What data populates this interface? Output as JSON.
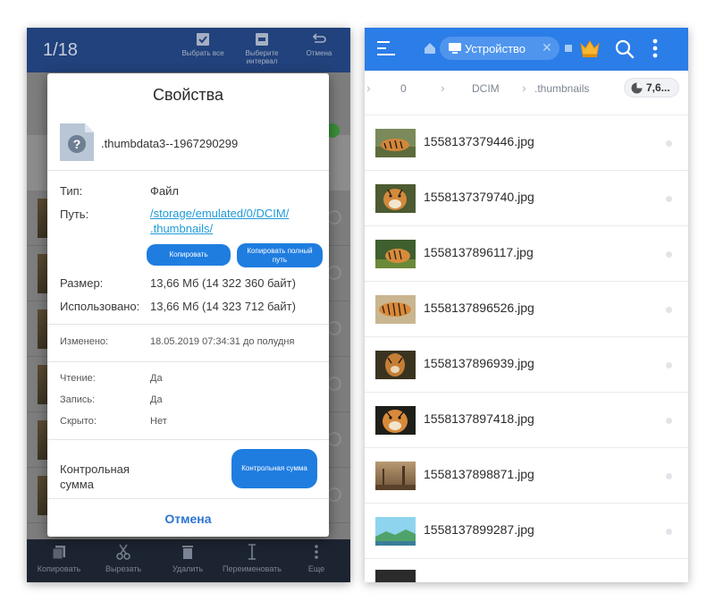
{
  "left": {
    "counter": "1/18",
    "top_actions": [
      {
        "label": "Выбрать все",
        "icon": "checkbox-icon"
      },
      {
        "label": "Выберите интервал",
        "icon": "interval-icon"
      },
      {
        "label": "Отмена",
        "icon": "undo-icon"
      }
    ],
    "bottom_actions": [
      {
        "label": "Копировать",
        "icon": "copy-icon"
      },
      {
        "label": "Вырезать",
        "icon": "scissors-icon"
      },
      {
        "label": "Удалить",
        "icon": "trash-icon"
      },
      {
        "label": "Переименовать",
        "icon": "rename-icon"
      },
      {
        "label": "Еще",
        "icon": "more-icon"
      }
    ],
    "dialog": {
      "title": "Свойства",
      "file_name": ".thumbdata3--1967290299",
      "type_label": "Тип:",
      "type_value": "Файл",
      "path_label": "Путь:",
      "path_value_line1": "/storage/emulated/0/DCIM/",
      "path_value_line2": ".thumbnails/",
      "copy_button": "Копировать",
      "copy_full_line1": "Копировать полный",
      "copy_full_line2": "путь",
      "size_label": "Размер:",
      "size_value": "13,66 Мб (14 322 360 байт)",
      "used_label": "Использовано:",
      "used_value": "13,66 Мб (14 323 712 байт)",
      "modified_label": "Изменено:",
      "modified_value": "18.05.2019 07:34:31 до полудня",
      "read_label": "Чтение:",
      "read_value": "Да",
      "write_label": "Запись:",
      "write_value": "Да",
      "hidden_label": "Скрыто:",
      "hidden_value": "Нет",
      "checksum_label_line1": "Контрольная",
      "checksum_label_line2": "сумма",
      "checksum_button": "Контрольная сумма",
      "cancel": "Отмена"
    }
  },
  "right": {
    "location_chip": "Устройство",
    "breadcrumbs": [
      "0",
      "DCIM",
      ".thumbnails"
    ],
    "storage": "7,6...",
    "files": [
      {
        "name": "1558137379446.jpg",
        "thumb": "tiger-lying"
      },
      {
        "name": "1558137379740.jpg",
        "thumb": "tiger-face"
      },
      {
        "name": "1558137896117.jpg",
        "thumb": "tiger-grass"
      },
      {
        "name": "1558137896526.jpg",
        "thumb": "tiger-walking"
      },
      {
        "name": "1558137896939.jpg",
        "thumb": "tiger-standing"
      },
      {
        "name": "1558137897418.jpg",
        "thumb": "tiger-portrait"
      },
      {
        "name": "1558137898871.jpg",
        "thumb": "foggy-landscape"
      },
      {
        "name": "1558137899287.jpg",
        "thumb": "sky-landscape"
      }
    ]
  },
  "colors": {
    "accent_blue": "#2b7de8",
    "button_blue": "#1f7de0",
    "link_blue": "#1f9bd7",
    "left_topbar": "#1b3f7e",
    "left_bottombar": "#1d2431"
  }
}
